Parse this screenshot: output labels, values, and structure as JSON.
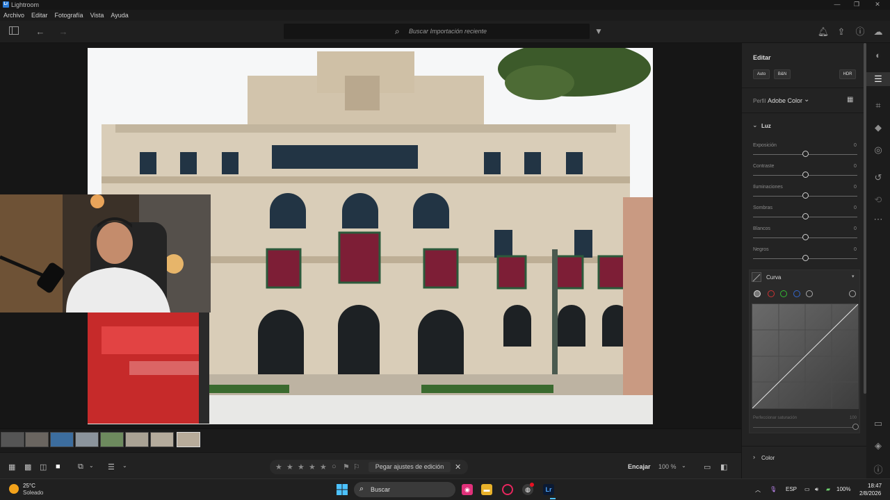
{
  "window": {
    "app_badge": "Lr",
    "title": "Lightroom"
  },
  "menu": [
    "Archivo",
    "Editar",
    "Fotografía",
    "Vista",
    "Ayuda"
  ],
  "search": {
    "placeholder": "Buscar Importación reciente"
  },
  "edit_panel": {
    "title": "Editar",
    "auto_label": "Auto",
    "bw_label": "B&N",
    "hdr_label": "HDR",
    "profile_label": "Perfil",
    "profile_value": "Adobe Color",
    "light_section": "Luz",
    "sliders": [
      {
        "label": "Exposición",
        "value": "0"
      },
      {
        "label": "Contraste",
        "value": "0"
      },
      {
        "label": "Iluminaciones",
        "value": "0"
      },
      {
        "label": "Sombras",
        "value": "0"
      },
      {
        "label": "Blancos",
        "value": "0"
      },
      {
        "label": "Negros",
        "value": "0"
      }
    ],
    "curve_section": "Curva",
    "refine_saturation_label": "Perfeccionar saturación",
    "refine_saturation_value": "100",
    "color_section": "Color"
  },
  "bottom_bar": {
    "paste_label": "Pegar ajustes de edición",
    "fit_label": "Encajar",
    "zoom_label": "100 %"
  },
  "taskbar": {
    "weather_temp": "25°C",
    "weather_desc": "Soleado",
    "search_label": "Buscar",
    "lang": "ESP",
    "battery": "100%",
    "time": "18:47",
    "date": "2/8/2026"
  },
  "colors": {
    "accent": "#2b7bd6",
    "panel_bg": "#232323",
    "viewer_bg": "#161616"
  }
}
